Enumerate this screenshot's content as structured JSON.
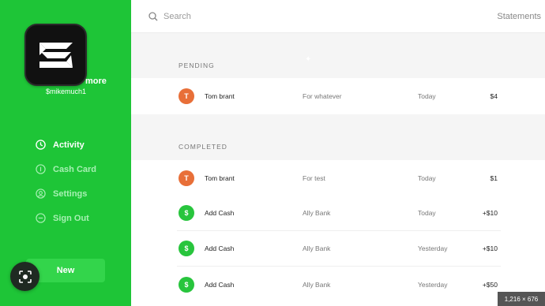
{
  "sidebar": {
    "logo_icon": "app-logo-icon",
    "profile_name": "more",
    "profile_handle": "$mikemuch1",
    "nav": [
      {
        "label": "Activity",
        "icon": "clock-icon",
        "active": true
      },
      {
        "label": "Cash Card",
        "icon": "card-icon",
        "active": false
      },
      {
        "label": "Settings",
        "icon": "settings-icon",
        "active": false
      },
      {
        "label": "Sign Out",
        "icon": "sign-out-icon",
        "active": false
      }
    ],
    "new_label": "New",
    "lens_icon": "lens-icon",
    "accent": "#1ec537"
  },
  "topbar": {
    "search_placeholder": "Search",
    "statements_label": "Statements"
  },
  "pending": {
    "label": "PENDING",
    "rows": [
      {
        "avatar": "T",
        "name": "Tom brant",
        "note": "For whatever",
        "date": "Today",
        "amount": "$4"
      }
    ]
  },
  "completed": {
    "label": "COMPLETED",
    "rows": [
      {
        "avatar": "T",
        "name": "Tom brant",
        "note": "For test",
        "date": "Today",
        "amount": "$1"
      },
      {
        "avatar": "$",
        "name": "Add Cash",
        "note": "Ally Bank",
        "date": "Today",
        "amount": "+$10"
      },
      {
        "avatar": "$",
        "name": "Add Cash",
        "note": "Ally Bank",
        "date": "Yesterday",
        "amount": "+$10"
      },
      {
        "avatar": "$",
        "name": "Add Cash",
        "note": "Ally Bank",
        "date": "Yesterday",
        "amount": "+$50"
      }
    ]
  },
  "overlay": {
    "dimensions": "1,216 × 676"
  }
}
